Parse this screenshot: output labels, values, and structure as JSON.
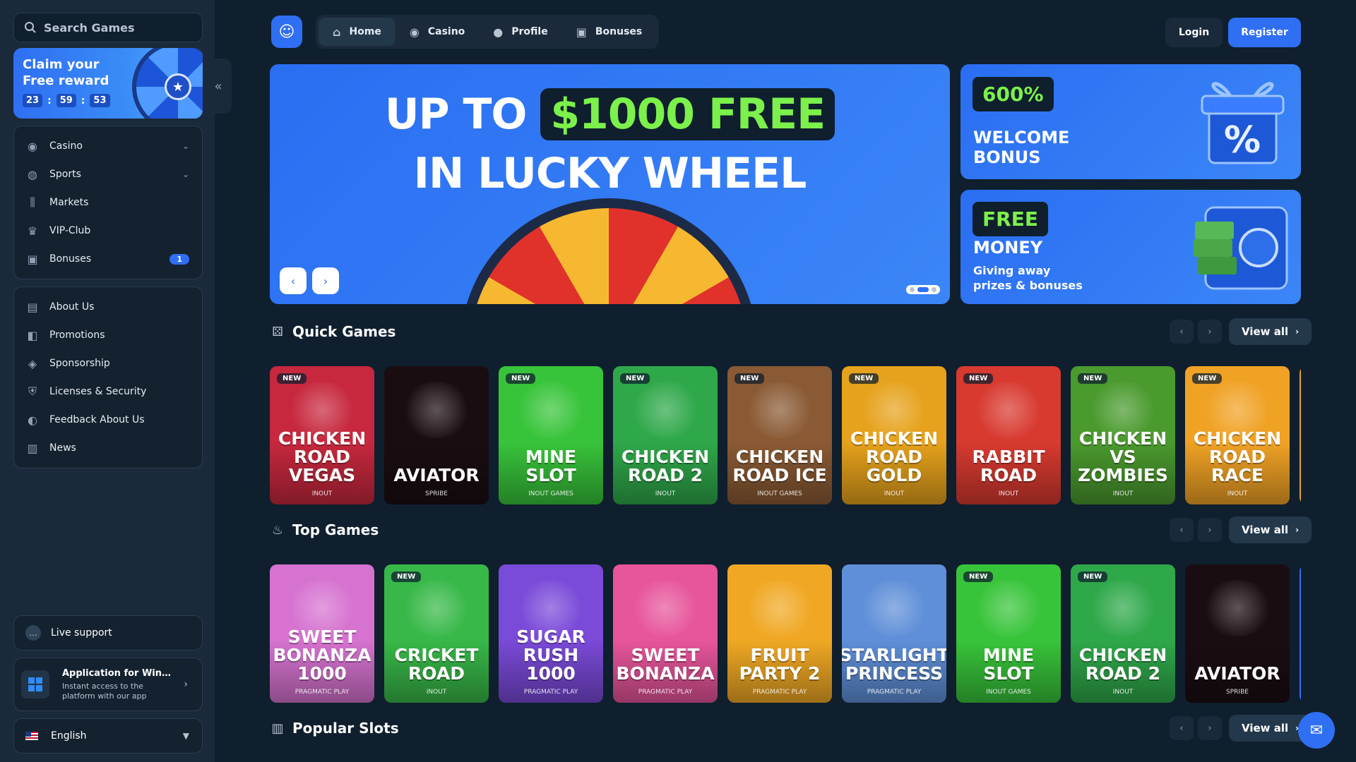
{
  "search": {
    "placeholder": "Search Games"
  },
  "reward": {
    "title": "Claim your\nFree reward",
    "hours": "23",
    "minutes": "59",
    "seconds": "53"
  },
  "sidebar": {
    "main": [
      {
        "label": "Casino",
        "icon": "casino-chip-icon",
        "expand": true
      },
      {
        "label": "Sports",
        "icon": "globe-icon",
        "expand": true
      },
      {
        "label": "Markets",
        "icon": "candles-icon"
      },
      {
        "label": "VIP-Club",
        "icon": "crown-icon"
      },
      {
        "label": "Bonuses",
        "icon": "gift-icon",
        "badge": "1"
      }
    ],
    "info": [
      {
        "label": "About Us",
        "icon": "book-icon"
      },
      {
        "label": "Promotions",
        "icon": "megaphone-icon"
      },
      {
        "label": "Sponsorship",
        "icon": "medal-icon"
      },
      {
        "label": "Licenses & Security",
        "icon": "shield-icon"
      },
      {
        "label": "Feedback About Us",
        "icon": "feedback-icon"
      },
      {
        "label": "News",
        "icon": "newspaper-icon"
      }
    ],
    "support": "Live support",
    "app": {
      "title": "Application for Windows",
      "subtitle": "Instant access to the platform with our app"
    },
    "language": "English"
  },
  "header": {
    "tabs": [
      {
        "label": "Home",
        "active": true
      },
      {
        "label": "Casino"
      },
      {
        "label": "Profile"
      },
      {
        "label": "Bonuses"
      }
    ],
    "login": "Login",
    "register": "Register"
  },
  "hero": {
    "prefix": "UP TO",
    "highlight": "$1000 FREE",
    "line2": "IN LUCKY WHEEL",
    "slides": 3,
    "active_slide": 2
  },
  "promos": [
    {
      "pill": "600%",
      "title": "WELCOME\nBONUS"
    },
    {
      "pill": "FREE",
      "title": "MONEY",
      "subtitle": "Giving away\nprizes & bonuses"
    }
  ],
  "sections": [
    {
      "title": "Quick Games",
      "view_all": "View all",
      "games": [
        {
          "name": "Chicken Road Vegas",
          "provider": "INOUT",
          "new": true,
          "color": "#c7283e"
        },
        {
          "name": "Aviator",
          "provider": "SPRIBE",
          "new": false,
          "color": "#1a0d12"
        },
        {
          "name": "Mine Slot",
          "provider": "INOUT GAMES",
          "new": true,
          "color": "#38c43a"
        },
        {
          "name": "Chicken Road 2",
          "provider": "INOUT",
          "new": true,
          "color": "#2fa84a"
        },
        {
          "name": "Chicken Road Ice",
          "provider": "INOUT GAMES",
          "new": true,
          "color": "#8a5a34"
        },
        {
          "name": "Chicken Road Gold",
          "provider": "INOUT",
          "new": true,
          "color": "#e6a21c"
        },
        {
          "name": "Rabbit Road",
          "provider": "INOUT",
          "new": true,
          "color": "#d83a30"
        },
        {
          "name": "Chicken VS Zombies",
          "provider": "INOUT",
          "new": true,
          "color": "#4a9a2e"
        },
        {
          "name": "Chicken Road Race",
          "provider": "INOUT",
          "new": true,
          "color": "#f0a225"
        }
      ]
    },
    {
      "title": "Top Games",
      "view_all": "View all",
      "games": [
        {
          "name": "Sweet Bonanza 1000",
          "provider": "PRAGMATIC PLAY",
          "new": false,
          "color": "#d673d0"
        },
        {
          "name": "Cricket Road",
          "provider": "INOUT",
          "new": true,
          "color": "#38b848"
        },
        {
          "name": "Sugar Rush 1000",
          "provider": "PRAGMATIC PLAY",
          "new": false,
          "color": "#7a4ad8"
        },
        {
          "name": "Sweet Bonanza",
          "provider": "PRAGMATIC PLAY",
          "new": false,
          "color": "#e7559b"
        },
        {
          "name": "Fruit Party 2",
          "provider": "PRAGMATIC PLAY",
          "new": false,
          "color": "#f0a824"
        },
        {
          "name": "Starlight Princess",
          "provider": "PRAGMATIC PLAY",
          "new": false,
          "color": "#5f8fd8"
        },
        {
          "name": "Mine Slot",
          "provider": "INOUT GAMES",
          "new": true,
          "color": "#38c43a"
        },
        {
          "name": "Chicken Road 2",
          "provider": "INOUT",
          "new": true,
          "color": "#2fa84a"
        },
        {
          "name": "Aviator",
          "provider": "SPRIBE",
          "new": false,
          "color": "#1a0d12"
        }
      ]
    },
    {
      "title": "Popular Slots",
      "view_all": "View all",
      "games": []
    }
  ]
}
